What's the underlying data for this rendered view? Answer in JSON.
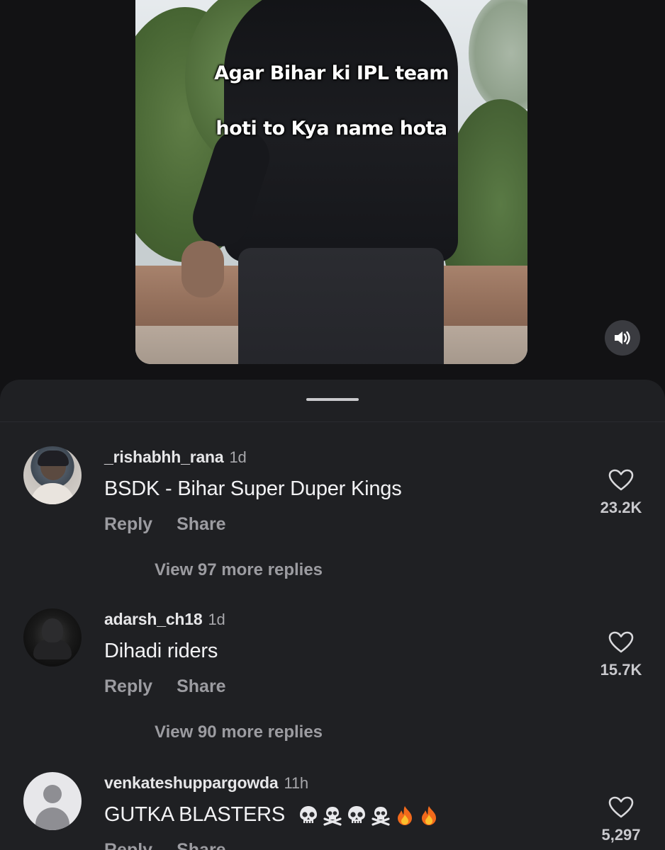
{
  "video": {
    "caption_line1": "Agar Bihar ki IPL team",
    "caption_line2": "hoti to Kya name hota",
    "sound_icon": "speaker-sound-icon"
  },
  "comments": [
    {
      "username": "_rishabhh_rana",
      "time": "1d",
      "text": "BSDK - Bihar Super Duper Kings",
      "reply_label": "Reply",
      "share_label": "Share",
      "view_replies": "View 97 more replies",
      "likes": "23.2K"
    },
    {
      "username": "adarsh_ch18",
      "time": "1d",
      "text": "Dihadi riders",
      "reply_label": "Reply",
      "share_label": "Share",
      "view_replies": "View 90 more replies",
      "likes": "15.7K"
    },
    {
      "username": "venkateshuppargowda",
      "time": "11h",
      "text": "GUTKA BLASTERS",
      "emojis": [
        "skull-icon",
        "skull-crossbones-icon",
        "skull-icon",
        "skull-crossbones-icon",
        "fire-icon",
        "fire-icon"
      ],
      "reply_label": "Reply",
      "share_label": "Share",
      "likes": "5,297"
    }
  ],
  "colors": {
    "background": "#121214",
    "sheet": "#1f2023",
    "secondary_text": "#9c9ca1"
  }
}
